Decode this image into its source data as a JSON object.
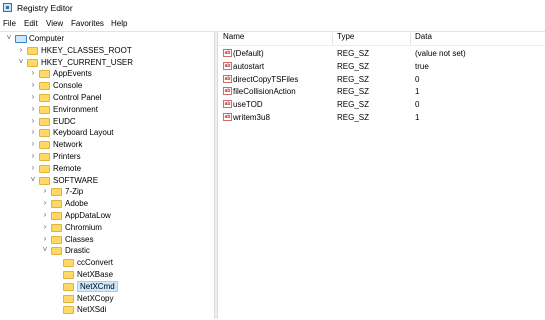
{
  "window": {
    "title": "Registry Editor",
    "icon": "regedit-icon"
  },
  "menu": [
    "File",
    "Edit",
    "View",
    "Favorites",
    "Help"
  ],
  "tree": [
    {
      "label": "Computer",
      "depth": 0,
      "expanded": true,
      "icon": "computer-icon"
    },
    {
      "label": "HKEY_CLASSES_ROOT",
      "depth": 1,
      "expanded": false,
      "icon": "folder-icon"
    },
    {
      "label": "HKEY_CURRENT_USER",
      "depth": 1,
      "expanded": true,
      "icon": "folder-icon"
    },
    {
      "label": "AppEvents",
      "depth": 2,
      "expanded": false,
      "icon": "folder-icon"
    },
    {
      "label": "Console",
      "depth": 2,
      "expanded": false,
      "icon": "folder-icon"
    },
    {
      "label": "Control Panel",
      "depth": 2,
      "expanded": false,
      "icon": "folder-icon"
    },
    {
      "label": "Environment",
      "depth": 2,
      "expanded": false,
      "icon": "folder-icon"
    },
    {
      "label": "EUDC",
      "depth": 2,
      "expanded": false,
      "icon": "folder-icon"
    },
    {
      "label": "Keyboard Layout",
      "depth": 2,
      "expanded": false,
      "icon": "folder-icon"
    },
    {
      "label": "Network",
      "depth": 2,
      "expanded": false,
      "icon": "folder-icon"
    },
    {
      "label": "Printers",
      "depth": 2,
      "expanded": false,
      "icon": "folder-icon"
    },
    {
      "label": "Remote",
      "depth": 2,
      "expanded": false,
      "icon": "folder-icon"
    },
    {
      "label": "SOFTWARE",
      "depth": 2,
      "expanded": true,
      "icon": "folder-icon"
    },
    {
      "label": "7-Zip",
      "depth": 3,
      "expanded": false,
      "icon": "folder-icon"
    },
    {
      "label": "Adobe",
      "depth": 3,
      "expanded": false,
      "icon": "folder-icon"
    },
    {
      "label": "AppDataLow",
      "depth": 3,
      "expanded": false,
      "icon": "folder-icon"
    },
    {
      "label": "Chromium",
      "depth": 3,
      "expanded": false,
      "icon": "folder-icon"
    },
    {
      "label": "Classes",
      "depth": 3,
      "expanded": false,
      "icon": "folder-icon"
    },
    {
      "label": "Drastic",
      "depth": 3,
      "expanded": true,
      "icon": "folder-icon"
    },
    {
      "label": "ccConvert",
      "depth": 4,
      "expanded": null,
      "icon": "folder-icon"
    },
    {
      "label": "NetXBase",
      "depth": 4,
      "expanded": null,
      "icon": "folder-icon"
    },
    {
      "label": "NetXCmd",
      "depth": 4,
      "expanded": null,
      "icon": "folder-icon",
      "selected": true
    },
    {
      "label": "NetXCopy",
      "depth": 4,
      "expanded": null,
      "icon": "folder-icon"
    },
    {
      "label": "NetXSdi",
      "depth": 4,
      "expanded": null,
      "icon": "folder-icon"
    }
  ],
  "values": {
    "headers": {
      "name": "Name",
      "type": "Type",
      "data": "Data"
    },
    "rows": [
      {
        "name": "(Default)",
        "type": "REG_SZ",
        "data": "(value not set)"
      },
      {
        "name": "autostart",
        "type": "REG_SZ",
        "data": "true"
      },
      {
        "name": "directCopyTSFiles",
        "type": "REG_SZ",
        "data": "0"
      },
      {
        "name": "fileCollisionAction",
        "type": "REG_SZ",
        "data": "1"
      },
      {
        "name": "useTOD",
        "type": "REG_SZ",
        "data": "0"
      },
      {
        "name": "writem3u8",
        "type": "REG_SZ",
        "data": "1"
      }
    ],
    "icon": "string-value-icon"
  }
}
